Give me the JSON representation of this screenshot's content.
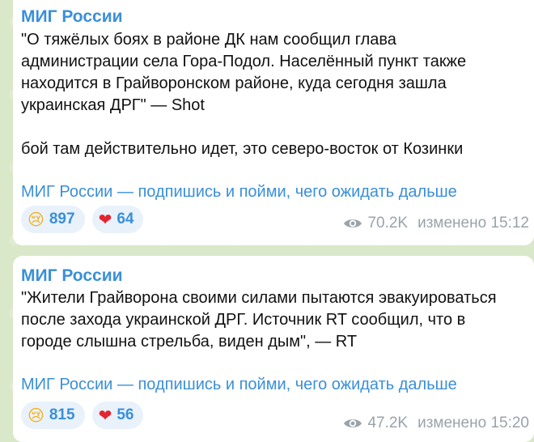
{
  "messages": [
    {
      "sender": "МИГ России",
      "text_lines": [
        "\"О тяжёлых боях в районе ДК нам сообщил глава",
        "администрации села Гора-Подол. Населённый пункт также",
        "находится в Грайворонском районе, куда сегодня зашла",
        "украинская ДРГ\" — Shot",
        "",
        "бой там действительно идет, это северо-восток от Козинки"
      ],
      "link": "МИГ России — подпишись и пойми, чего ожидать дальше",
      "reactions": [
        {
          "emoji": "😢",
          "count": "897"
        },
        {
          "emoji": "❤",
          "count": "64"
        }
      ],
      "views": "70.2K",
      "edited_label": "изменено",
      "time": "15:12"
    },
    {
      "sender": "МИГ России",
      "text_lines": [
        "\"Жители Грайворона своими силами пытаются эвакуироваться",
        "после захода украинской ДРГ. Источник RT сообщил, что в",
        "городе слышна стрельба, виден дым\", — RT"
      ],
      "link": "МИГ России — подпишись и пойми, чего ожидать дальше",
      "reactions": [
        {
          "emoji": "😢",
          "count": "815"
        },
        {
          "emoji": "❤",
          "count": "56"
        }
      ],
      "views": "47.2K",
      "edited_label": "изменено",
      "time": "15:20"
    }
  ],
  "colors": {
    "background": "#d9e8c8",
    "bubble": "#ffffff",
    "accent": "#3a8fd8",
    "meta": "#9aa3a9",
    "reaction_bg": "#e9f2fb"
  }
}
